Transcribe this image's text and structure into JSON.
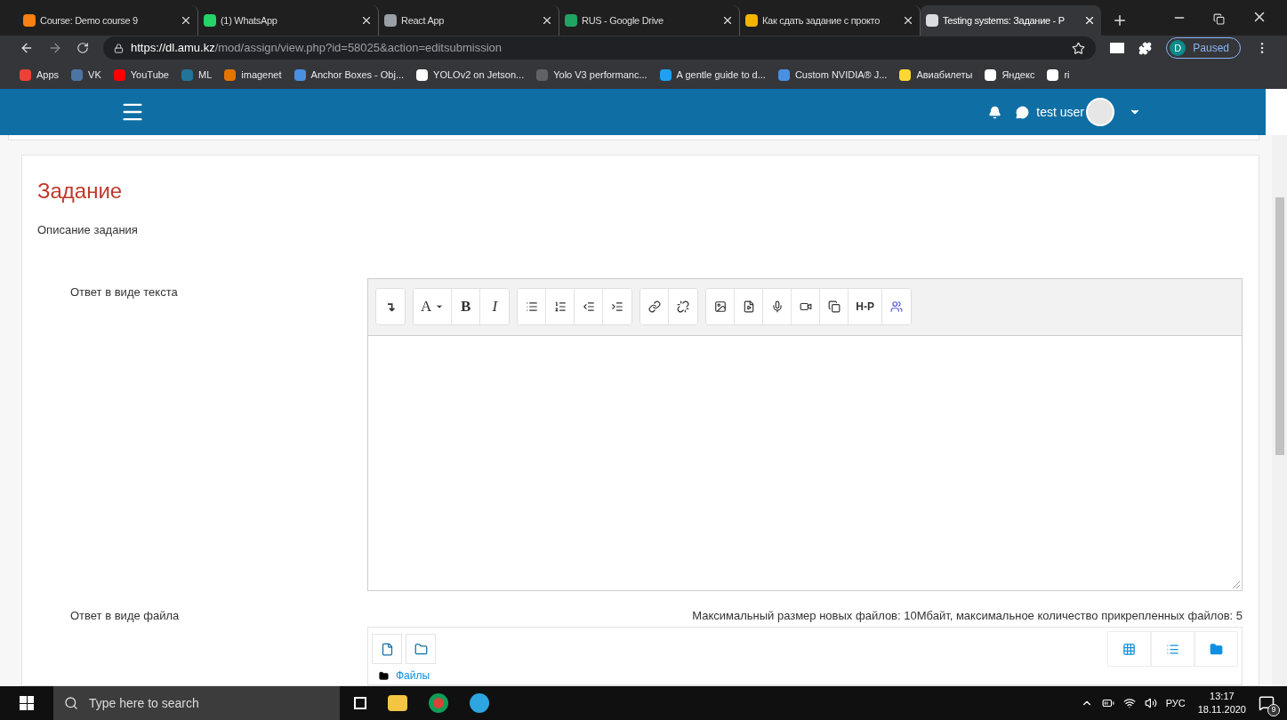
{
  "browser": {
    "tabs": [
      {
        "title": "Course: Demo course 9",
        "selected": false
      },
      {
        "title": "(1) WhatsApp",
        "selected": false
      },
      {
        "title": "React App",
        "selected": false
      },
      {
        "title": "RUS - Google Drive",
        "selected": false
      },
      {
        "title": "Как сдать задание с прокто",
        "selected": false
      },
      {
        "title": "Testing systems: Задание - P",
        "selected": true
      }
    ],
    "url_host": "https://dl.amu.kz",
    "url_path": "/mod/assign/view.php?id=58025&action=editsubmission",
    "profile_initial": "D",
    "profile_status": "Paused",
    "bookmarks": [
      "Apps",
      "VK",
      "YouTube",
      "ML",
      "imagenet",
      "Anchor Boxes - Obj...",
      "YOLOv2 on Jetson...",
      "Yolo V3 performanc...",
      "A gentle guide to d...",
      "Custom NVIDIA® J...",
      "Авиабилеты",
      "Яндекс",
      "ri"
    ]
  },
  "header": {
    "user": "test user"
  },
  "page": {
    "title": "Задание",
    "description": "Описание задания",
    "text_answer": {
      "label": "Ответ в виде текста",
      "toolbar": {
        "insert": "↴",
        "font": "A",
        "bold": "B",
        "italic": "I",
        "h5p": "H-P"
      }
    },
    "file_answer": {
      "label": "Ответ в виде файла",
      "limits": "Максимальный размер новых файлов: 10Мбайт, максимальное количество прикрепленных файлов: 5",
      "folder": "Файлы"
    }
  },
  "taskbar": {
    "search_placeholder": "Type here to search",
    "language": "РУС",
    "time": "13:17",
    "date": "18.11.2020",
    "notifications": "9"
  }
}
